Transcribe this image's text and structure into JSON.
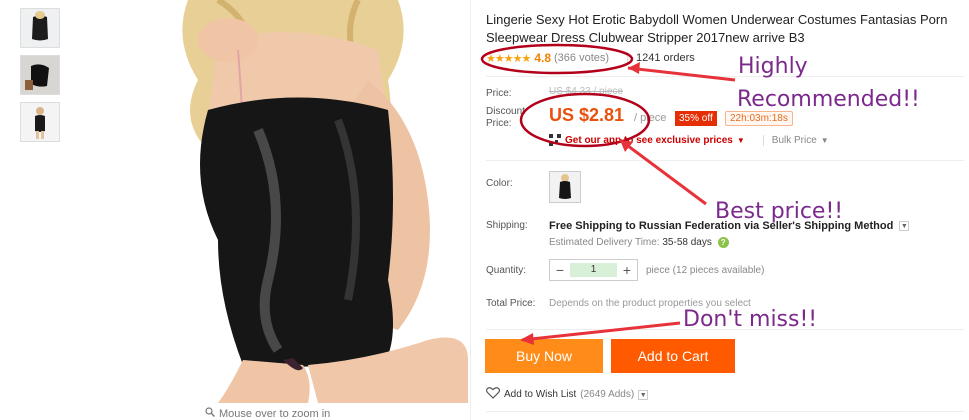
{
  "thumbnails": [
    "thumbnail-1",
    "thumbnail-2",
    "thumbnail-3"
  ],
  "zoom_hint": "Mouse over to zoom in",
  "product": {
    "title": "Lingerie Sexy Hot Erotic Babydoll Women Underwear Costumes Fantasias Porn Sleepwear Dress Clubwear Stripper 2017new arrive B3",
    "stars": "★★★★★",
    "rating": "4.8",
    "votes": "(366 votes)",
    "orders": "1241 orders"
  },
  "price": {
    "label": "Price:",
    "old_price": "US $4.33 / piece",
    "discount_label": "Discount\nPrice:",
    "discount_label_1": "Discount",
    "discount_label_2": "Price:",
    "new_price": "US $2.81",
    "per_piece": "/ piece",
    "off_badge": "35% off",
    "timer": "22h:03m:18s",
    "app_link": "Get our app to see exclusive prices",
    "bulk_price": "Bulk Price"
  },
  "color": {
    "label": "Color:"
  },
  "shipping": {
    "label": "Shipping:",
    "prefix": "Free Shipping to ",
    "destination": "Russian Federation via Seller's Shipping Method",
    "eta_label": "Estimated Delivery Time: ",
    "eta_days": "35-58 days"
  },
  "quantity": {
    "label": "Quantity:",
    "minus": "−",
    "value": "1",
    "plus": "+",
    "note": "piece (12 pieces available)"
  },
  "total": {
    "label": "Total Price:",
    "note": "Depends on the product properties you select"
  },
  "actions": {
    "buy_now": "Buy Now",
    "add_to_cart": "Add to Cart",
    "wish_list": "Add to Wish List",
    "wish_adds": "(2649 Adds)"
  },
  "annotations": {
    "highly": "Highly",
    "recommended": "Recommended!!",
    "best_price": "Best price!!",
    "dont_miss": "Don't miss!!"
  },
  "colors": {
    "accent_red": "#e62e04",
    "price_orange": "#e9510e",
    "buy_now_bg": "#ff8c19",
    "add_to_cart_bg": "#ff5a00",
    "annotation": "#7b2a8c"
  }
}
